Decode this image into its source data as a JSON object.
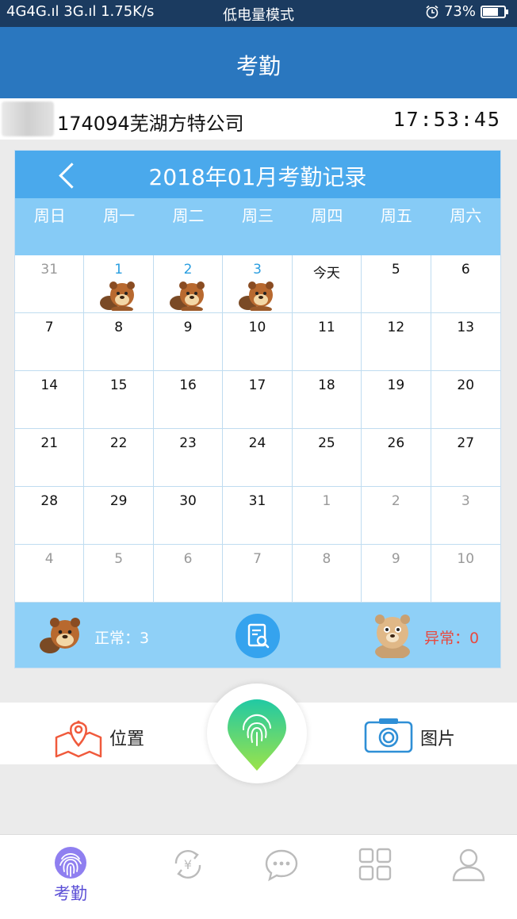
{
  "status_bar": {
    "signal": "4G4G.ıl 3G.ıl 1.75K/s",
    "mode": "低电量模式",
    "battery": "73%",
    "battery_level": 0.73
  },
  "header": {
    "title": "考勤"
  },
  "company": {
    "name": "174094芜湖方特公司",
    "time": "17:53:45"
  },
  "calendar": {
    "title": "2018年01月考勤记录",
    "weekdays": [
      "周日",
      "周一",
      "周二",
      "周三",
      "周四",
      "周五",
      "周六"
    ],
    "weeks": [
      [
        "31",
        "1",
        "2",
        "3",
        "今天",
        "5",
        "6"
      ],
      [
        "7",
        "8",
        "9",
        "10",
        "11",
        "12",
        "13"
      ],
      [
        "14",
        "15",
        "16",
        "17",
        "18",
        "19",
        "20"
      ],
      [
        "21",
        "22",
        "23",
        "24",
        "25",
        "26",
        "27"
      ],
      [
        "28",
        "29",
        "30",
        "31",
        "1",
        "2",
        "3"
      ],
      [
        "4",
        "5",
        "6",
        "7",
        "8",
        "9",
        "10"
      ]
    ],
    "summary": {
      "normal": "正常：3",
      "abnormal": "异常：0"
    }
  },
  "actions": {
    "location": "位置",
    "picture": "图片"
  },
  "tabs": [
    {
      "label": "考勤",
      "icon": "fingerprint-icon",
      "active": true
    },
    {
      "label": "",
      "icon": "yen-exchange-icon"
    },
    {
      "label": "",
      "icon": "chat-icon"
    },
    {
      "label": "",
      "icon": "apps-icon"
    },
    {
      "label": "",
      "icon": "user-icon"
    }
  ],
  "colors": {
    "header": "#2a77bf",
    "calendar_head": "#4aa9ec",
    "accent": "#5b4fd6",
    "abnormal": "#e8493f"
  }
}
